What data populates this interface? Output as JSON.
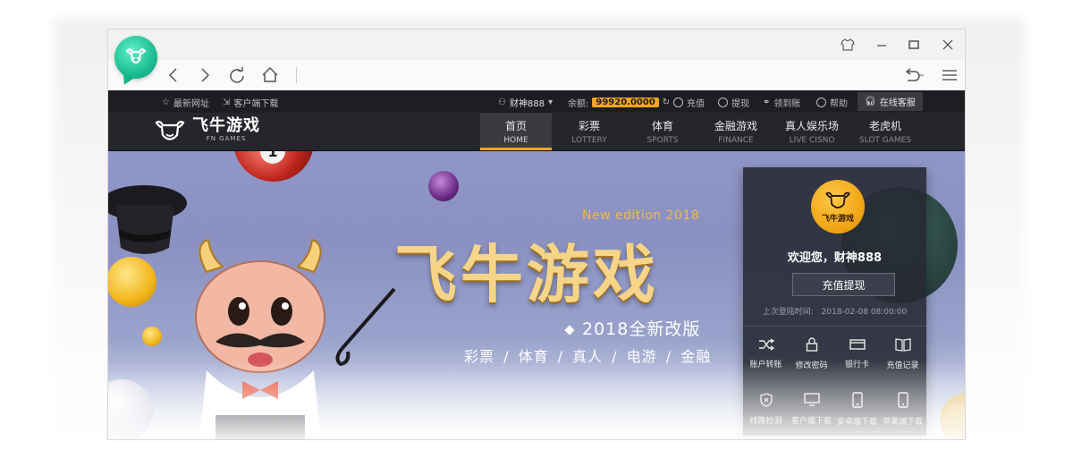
{
  "browser": {
    "logo_icon": "bull-logo-icon",
    "window_controls": [
      "shirt-skin-icon",
      "minimize-icon",
      "maximize-icon",
      "close-icon"
    ],
    "nav": {
      "back": "‹",
      "forward": "›",
      "refresh": "↻",
      "home": "⌂",
      "undo": "↶",
      "menu": "≡"
    }
  },
  "topbar": {
    "latest_url": "最新网址",
    "client_download": "客户端下载",
    "username": "财神888",
    "balance_label": "余额:",
    "balance_value": "99920.0000",
    "recharge": "充值",
    "withdraw": "提现",
    "check_in": "领到账",
    "help": "帮助",
    "customer_service": "在线客服"
  },
  "logo": {
    "cn": "飞牛游戏",
    "en": "FN GAMES"
  },
  "menu": [
    {
      "cn": "首页",
      "en": "HOME"
    },
    {
      "cn": "彩票",
      "en": "LOTTERY"
    },
    {
      "cn": "体育",
      "en": "SPORTS"
    },
    {
      "cn": "金融游戏",
      "en": "FINANCE"
    },
    {
      "cn": "真人娱乐场",
      "en": "LIVE CISNO"
    },
    {
      "cn": "老虎机",
      "en": "SLOT GAMES"
    }
  ],
  "banner": {
    "edition": "New edition 2018",
    "title": "飞牛游戏",
    "subtitle": "2018全新改版",
    "categories": "彩票 / 体育 / 真人 / 电游 / 金融",
    "ball_number": "1"
  },
  "panel": {
    "logo_text": "飞牛游戏",
    "welcome": "欢迎您，财神888",
    "recharge_withdraw": "充值提现",
    "last_login_label": "上次登陆时间:",
    "last_login_value": "2018-02-08 08:00:00",
    "actions": [
      {
        "label": "账户转账",
        "icon": "transfer-icon"
      },
      {
        "label": "修改密码",
        "icon": "lock-icon"
      },
      {
        "label": "银行卡",
        "icon": "card-icon"
      },
      {
        "label": "充值记录",
        "icon": "book-icon"
      },
      {
        "label": "线路检测",
        "icon": "shield-icon"
      },
      {
        "label": "客户端下载",
        "icon": "monitor-icon"
      },
      {
        "label": "安卓端下载",
        "icon": "android-phone-icon"
      },
      {
        "label": "苹果端下载",
        "icon": "iphone-icon"
      }
    ]
  },
  "colors": {
    "accent": "#f3a51c",
    "topbar_bg": "#1d1e22",
    "nav_bg": "#25262b",
    "browser_logo": "#18b98e"
  }
}
